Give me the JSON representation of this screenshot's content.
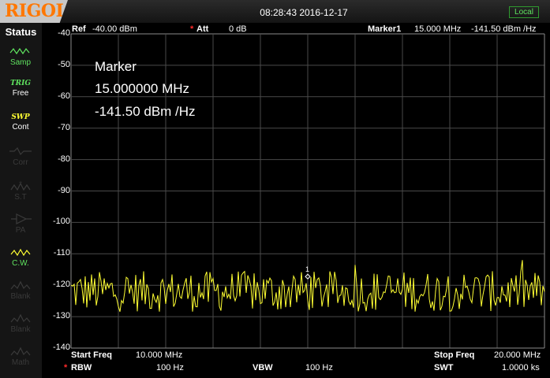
{
  "header": {
    "logo_text": "RIGOL",
    "datetime": "08:28:43 2016-12-17",
    "local_label": "Local"
  },
  "sidebar": {
    "title": "Status",
    "items": [
      {
        "icon": "samp-wave-icon",
        "label": "Samp",
        "enabled": true
      },
      {
        "icon": "trig-icon",
        "caption": "TRIG",
        "label": "Free",
        "enabled": true
      },
      {
        "icon": "swp-icon",
        "caption": "SWP",
        "label": "Cont",
        "enabled": true
      },
      {
        "icon": "corr-icon",
        "label": "Corr",
        "enabled": false
      },
      {
        "icon": "st-icon",
        "label": "S.T",
        "enabled": false
      },
      {
        "icon": "pa-icon",
        "label": "PA",
        "enabled": false
      },
      {
        "icon": "cw-icon",
        "label": "C.W.",
        "enabled": true
      },
      {
        "icon": "blank-wave-icon",
        "label": "Blank",
        "enabled": false
      },
      {
        "icon": "blank-wave-icon",
        "label": "Blank",
        "enabled": false
      },
      {
        "icon": "math-wave-icon",
        "label": "Math",
        "enabled": false
      }
    ]
  },
  "plot_header": {
    "ref_label": "Ref",
    "ref_value": "-40.00 dBm",
    "att_label": "Att",
    "att_value": "0 dB",
    "marker_label": "Marker1",
    "marker_freq": "15.000 MHz",
    "marker_level": "-141.50 dBm /Hz"
  },
  "marker_readout": {
    "title": "Marker",
    "freq": "15.000000 MHz",
    "level": "-141.50 dBm /Hz",
    "marker_number": "1"
  },
  "plot_footer": {
    "start_label": "Start Freq",
    "start_value": "10.000 MHz",
    "stop_label": "Stop Freq",
    "stop_value": "20.000 MHz",
    "rbw_label": "RBW",
    "rbw_value": "100 Hz",
    "vbw_label": "VBW",
    "vbw_value": "100 Hz",
    "swt_label": "SWT",
    "swt_value": "1.0000 ks"
  },
  "colors": {
    "trace": "#ffff33",
    "grid": "#4a4a4a",
    "accent_green": "#5fe35f",
    "logo_orange": "#ff7700",
    "marker_star": "#ff2a2a"
  },
  "chart_data": {
    "type": "line",
    "ylim": [
      -140,
      -40
    ],
    "yticks": [
      "-40",
      "-50",
      "-60",
      "-70",
      "-80",
      "-90",
      "-100",
      "-110",
      "-120",
      "-130",
      "-140"
    ],
    "xlim_mhz": [
      10,
      20
    ],
    "grid": true,
    "series": [
      {
        "noise_center_dbm": -122,
        "noise_min_dbm": -130,
        "noise_max_dbm": -112,
        "marker_x_mhz": 15,
        "marker_y_dbm": -118
      }
    ]
  }
}
